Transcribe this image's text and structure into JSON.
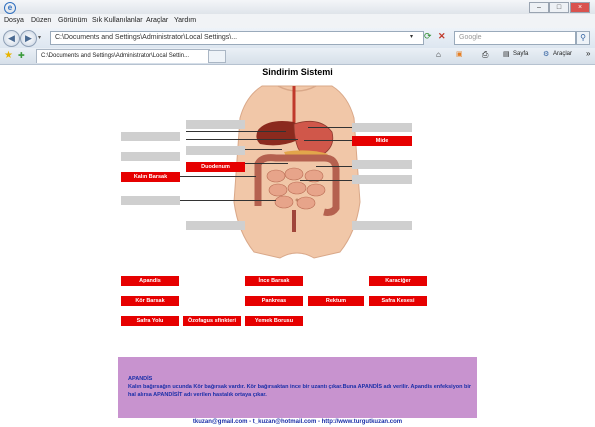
{
  "window": {
    "title": ""
  },
  "menu": [
    "Dosya",
    "Düzen",
    "Görünüm",
    "Sık Kullanılanlar",
    "Araçlar",
    "Yardım"
  ],
  "address": {
    "url": "C:\\Documents and Settings\\Administrator\\Local Settings\\..."
  },
  "search": {
    "placeholder": "Google"
  },
  "tab": {
    "title": "C:\\Documents and Settings\\Administrator\\Local Settin..."
  },
  "toolbar": {
    "page_label": "Sayfa",
    "tools_label": "Araçlar"
  },
  "page": {
    "title": "Sindirim Sistemi"
  },
  "diagram_labels": {
    "mide": "Mide",
    "duodenum": "Duodenum",
    "kalin_barsak": "Kalın Barsak"
  },
  "word_bank": {
    "apandis": "Apandis",
    "ince_barsak": "İnce Barsak",
    "karaciger": "Karaciğer",
    "kor_barsak": "Kör Barsak",
    "pankreas": "Pankreas",
    "rektum": "Rektum",
    "safra_kesesi": "Safra Kesesi",
    "safra_yolu": "Safra Yolu",
    "ozofagus": "Özofagus sfinkteri",
    "yemek_borusu": "Yemek Borusu"
  },
  "info": {
    "title": "APANDİS",
    "text": "Kalın bağırsağın ucunda Kör bağırsak vardır. Kör bağırsaktan ince bir uzantı çıkar.Buna APANDİS adı verilir. Apandis enfeksiyon bir hal alırsa APANDİSİT adı verilen hastalık ortaya çıkar."
  },
  "footer": "tkuzan@gmail.com  -  t_kuzan@hotmail.com  -  http://www.turgutkuzan.com",
  "colors": {
    "label_red": "#e60000",
    "blank_gray": "#cfcfcf",
    "info_bg": "#c893cf",
    "info_text": "#1a2fa8"
  }
}
